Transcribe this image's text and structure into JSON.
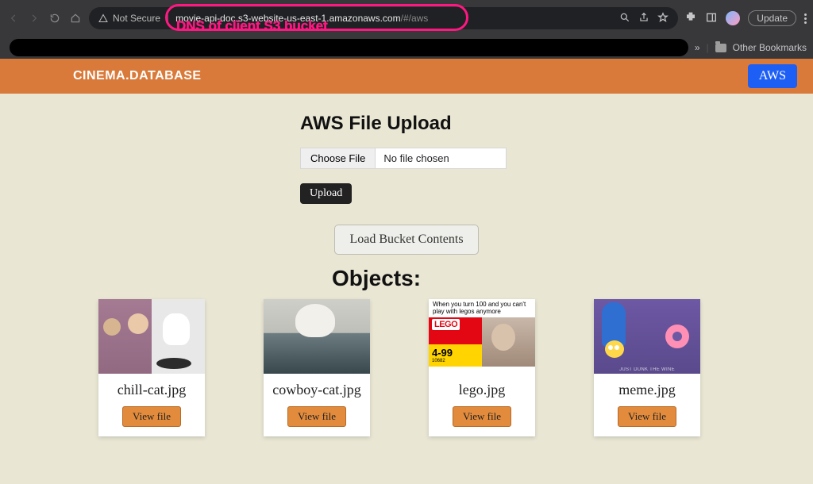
{
  "browser": {
    "security_label": "Not Secure",
    "url_main": "movie-api-doc.s3-website-us-east-1.amazonaws.com",
    "url_suffix": "/#/aws",
    "update_label": "Update",
    "annotation": "DNS of client S3 bucket",
    "bookmarks_label": "Other Bookmarks",
    "bookmarks_chevron": "»"
  },
  "header": {
    "brand": "CINEMA.DATABASE",
    "aws_button": "AWS"
  },
  "upload": {
    "title": "AWS File Upload",
    "choose_label": "Choose File",
    "status": "No file chosen",
    "upload_button": "Upload"
  },
  "bucket": {
    "load_button": "Load Bucket Contents",
    "objects_heading": "Objects:"
  },
  "objects": [
    {
      "filename": "chill-cat.jpg",
      "view_label": "View file"
    },
    {
      "filename": "cowboy-cat.jpg",
      "view_label": "View file"
    },
    {
      "filename": "lego.jpg",
      "view_label": "View file",
      "meme_text": "When you turn 100 and you can't play with legos anymore",
      "lego_logo": "LEGO",
      "lego_age": "4-99",
      "lego_age_sub": "10682"
    },
    {
      "filename": "meme.jpg",
      "view_label": "View file"
    }
  ]
}
